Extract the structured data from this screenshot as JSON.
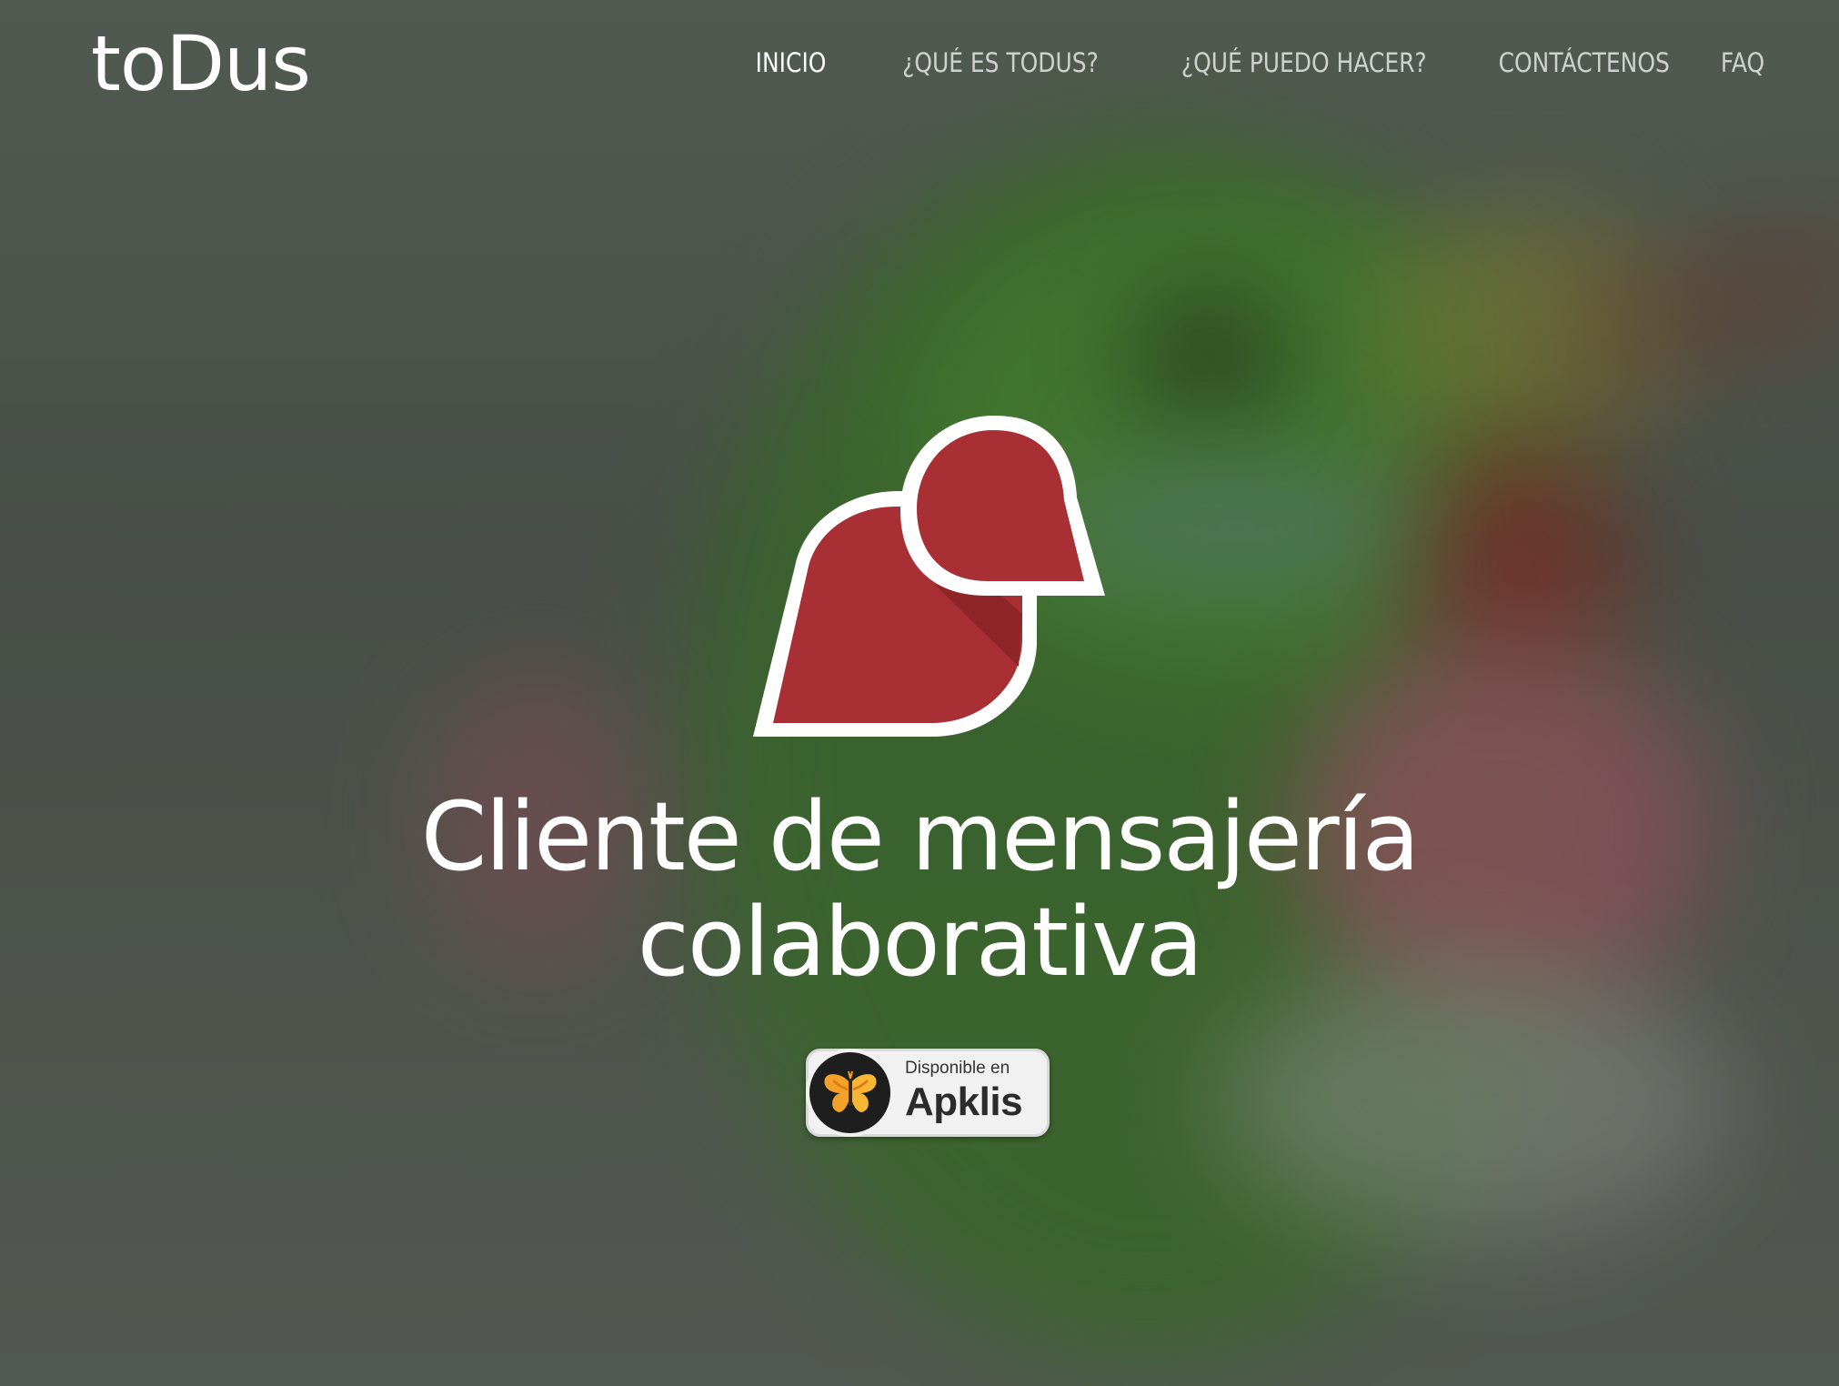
{
  "brand": {
    "name": "toDus"
  },
  "nav": {
    "items": [
      {
        "label": "INICIO",
        "active": true
      },
      {
        "label": "¿QUÉ ES TODUS?",
        "active": false
      },
      {
        "label": "¿QUÉ PUEDO HACER?",
        "active": false
      },
      {
        "label": "CONTÁCTENOS",
        "active": false
      },
      {
        "label": "FAQ",
        "active": false
      }
    ]
  },
  "hero": {
    "logo_icon": "todus-chat-bubbles-icon",
    "title_line1": "Cliente de mensajería",
    "title_line2": "colaborativa",
    "badge": {
      "icon": "butterfly-icon",
      "small_text": "Disponible en",
      "big_text": "Apklis"
    }
  },
  "colors": {
    "logo_red": "#a83034",
    "logo_red_shadow": "#8e2629",
    "logo_outline": "#ffffff",
    "nav_active": "#ffffff",
    "nav_inactive": "rgba(255,255,255,0.72)",
    "butterfly_orange": "#f4a12a"
  }
}
